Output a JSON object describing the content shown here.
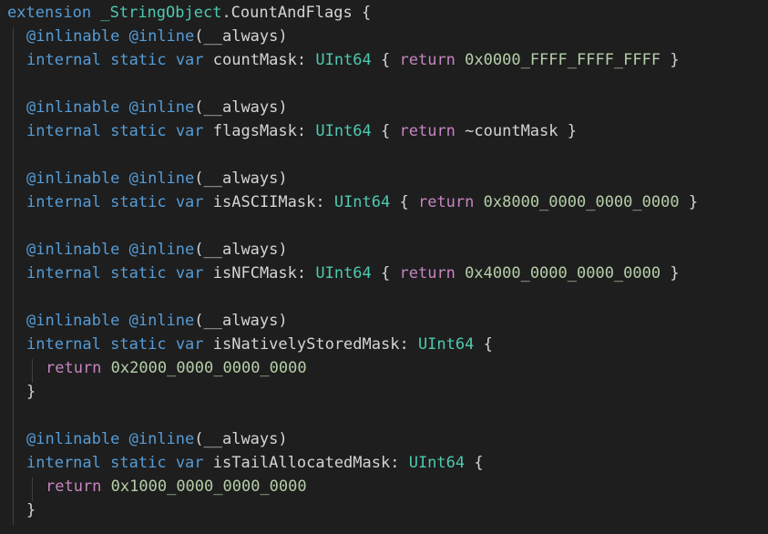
{
  "editor": {
    "theme_colors": {
      "background": "#1e1e1e",
      "keyword": "#569cd6",
      "type": "#4ec9b0",
      "control": "#c586c0",
      "number": "#b5cea8",
      "text": "#d4d4d4"
    },
    "lines": [
      {
        "indent": 0,
        "tokens": [
          {
            "c": "kw",
            "t": "extension"
          },
          {
            "c": "plain",
            "t": " "
          },
          {
            "c": "typedef",
            "t": "_StringObject"
          },
          {
            "c": "plain",
            "t": ".CountAndFlags {"
          }
        ]
      },
      {
        "indent": 1,
        "tokens": [
          {
            "c": "attr",
            "t": "@inlinable"
          },
          {
            "c": "plain",
            "t": " "
          },
          {
            "c": "attr",
            "t": "@inline"
          },
          {
            "c": "plain",
            "t": "(__always)"
          }
        ]
      },
      {
        "indent": 1,
        "tokens": [
          {
            "c": "kw",
            "t": "internal"
          },
          {
            "c": "plain",
            "t": " "
          },
          {
            "c": "kw",
            "t": "static"
          },
          {
            "c": "plain",
            "t": " "
          },
          {
            "c": "kw",
            "t": "var"
          },
          {
            "c": "plain",
            "t": " countMask: "
          },
          {
            "c": "type",
            "t": "UInt64"
          },
          {
            "c": "plain",
            "t": " { "
          },
          {
            "c": "ret",
            "t": "return"
          },
          {
            "c": "plain",
            "t": " "
          },
          {
            "c": "num",
            "t": "0x0000_FFFF_FFFF_FFFF"
          },
          {
            "c": "plain",
            "t": " }"
          }
        ]
      },
      {
        "indent": 1,
        "tokens": []
      },
      {
        "indent": 1,
        "tokens": [
          {
            "c": "attr",
            "t": "@inlinable"
          },
          {
            "c": "plain",
            "t": " "
          },
          {
            "c": "attr",
            "t": "@inline"
          },
          {
            "c": "plain",
            "t": "(__always)"
          }
        ]
      },
      {
        "indent": 1,
        "tokens": [
          {
            "c": "kw",
            "t": "internal"
          },
          {
            "c": "plain",
            "t": " "
          },
          {
            "c": "kw",
            "t": "static"
          },
          {
            "c": "plain",
            "t": " "
          },
          {
            "c": "kw",
            "t": "var"
          },
          {
            "c": "plain",
            "t": " flagsMask: "
          },
          {
            "c": "type",
            "t": "UInt64"
          },
          {
            "c": "plain",
            "t": " { "
          },
          {
            "c": "ret",
            "t": "return"
          },
          {
            "c": "plain",
            "t": " ~countMask }"
          }
        ]
      },
      {
        "indent": 1,
        "tokens": []
      },
      {
        "indent": 1,
        "tokens": [
          {
            "c": "attr",
            "t": "@inlinable"
          },
          {
            "c": "plain",
            "t": " "
          },
          {
            "c": "attr",
            "t": "@inline"
          },
          {
            "c": "plain",
            "t": "(__always)"
          }
        ]
      },
      {
        "indent": 1,
        "tokens": [
          {
            "c": "kw",
            "t": "internal"
          },
          {
            "c": "plain",
            "t": " "
          },
          {
            "c": "kw",
            "t": "static"
          },
          {
            "c": "plain",
            "t": " "
          },
          {
            "c": "kw",
            "t": "var"
          },
          {
            "c": "plain",
            "t": " isASCIIMask: "
          },
          {
            "c": "type",
            "t": "UInt64"
          },
          {
            "c": "plain",
            "t": " { "
          },
          {
            "c": "ret",
            "t": "return"
          },
          {
            "c": "plain",
            "t": " "
          },
          {
            "c": "num",
            "t": "0x8000_0000_0000_0000"
          },
          {
            "c": "plain",
            "t": " }"
          }
        ]
      },
      {
        "indent": 1,
        "tokens": []
      },
      {
        "indent": 1,
        "tokens": [
          {
            "c": "attr",
            "t": "@inlinable"
          },
          {
            "c": "plain",
            "t": " "
          },
          {
            "c": "attr",
            "t": "@inline"
          },
          {
            "c": "plain",
            "t": "(__always)"
          }
        ]
      },
      {
        "indent": 1,
        "tokens": [
          {
            "c": "kw",
            "t": "internal"
          },
          {
            "c": "plain",
            "t": " "
          },
          {
            "c": "kw",
            "t": "static"
          },
          {
            "c": "plain",
            "t": " "
          },
          {
            "c": "kw",
            "t": "var"
          },
          {
            "c": "plain",
            "t": " isNFCMask: "
          },
          {
            "c": "type",
            "t": "UInt64"
          },
          {
            "c": "plain",
            "t": " { "
          },
          {
            "c": "ret",
            "t": "return"
          },
          {
            "c": "plain",
            "t": " "
          },
          {
            "c": "num",
            "t": "0x4000_0000_0000_0000"
          },
          {
            "c": "plain",
            "t": " }"
          }
        ]
      },
      {
        "indent": 1,
        "tokens": []
      },
      {
        "indent": 1,
        "tokens": [
          {
            "c": "attr",
            "t": "@inlinable"
          },
          {
            "c": "plain",
            "t": " "
          },
          {
            "c": "attr",
            "t": "@inline"
          },
          {
            "c": "plain",
            "t": "(__always)"
          }
        ]
      },
      {
        "indent": 1,
        "tokens": [
          {
            "c": "kw",
            "t": "internal"
          },
          {
            "c": "plain",
            "t": " "
          },
          {
            "c": "kw",
            "t": "static"
          },
          {
            "c": "plain",
            "t": " "
          },
          {
            "c": "kw",
            "t": "var"
          },
          {
            "c": "plain",
            "t": " isNativelyStoredMask: "
          },
          {
            "c": "type",
            "t": "UInt64"
          },
          {
            "c": "plain",
            "t": " {"
          }
        ]
      },
      {
        "indent": 2,
        "tokens": [
          {
            "c": "ret",
            "t": "return"
          },
          {
            "c": "plain",
            "t": " "
          },
          {
            "c": "num",
            "t": "0x2000_0000_0000_0000"
          }
        ]
      },
      {
        "indent": 1,
        "tokens": [
          {
            "c": "plain",
            "t": "}"
          }
        ]
      },
      {
        "indent": 1,
        "tokens": []
      },
      {
        "indent": 1,
        "tokens": [
          {
            "c": "attr",
            "t": "@inlinable"
          },
          {
            "c": "plain",
            "t": " "
          },
          {
            "c": "attr",
            "t": "@inline"
          },
          {
            "c": "plain",
            "t": "(__always)"
          }
        ]
      },
      {
        "indent": 1,
        "tokens": [
          {
            "c": "kw",
            "t": "internal"
          },
          {
            "c": "plain",
            "t": " "
          },
          {
            "c": "kw",
            "t": "static"
          },
          {
            "c": "plain",
            "t": " "
          },
          {
            "c": "kw",
            "t": "var"
          },
          {
            "c": "plain",
            "t": " isTailAllocatedMask: "
          },
          {
            "c": "type",
            "t": "UInt64"
          },
          {
            "c": "plain",
            "t": " {"
          }
        ]
      },
      {
        "indent": 2,
        "tokens": [
          {
            "c": "ret",
            "t": "return"
          },
          {
            "c": "plain",
            "t": " "
          },
          {
            "c": "num",
            "t": "0x1000_0000_0000_0000"
          }
        ]
      },
      {
        "indent": 1,
        "tokens": [
          {
            "c": "plain",
            "t": "}"
          }
        ]
      }
    ]
  }
}
